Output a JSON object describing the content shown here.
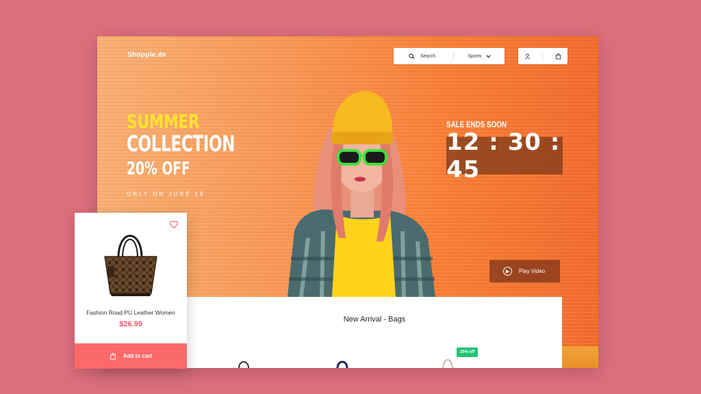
{
  "brand": "Shopple.de",
  "header": {
    "search_label": "Search",
    "category_selected": "Sports"
  },
  "hero": {
    "line1": "SUMMER",
    "line2": "COLLECTION",
    "line3": "20% OFF",
    "line4": "ONLY ON JUNE 18"
  },
  "sale": {
    "label": "SALE ENDS SOON",
    "timer": "12 : 30 : 45"
  },
  "video": {
    "label": "Play Video"
  },
  "panel": {
    "title": "New Arrival - Bags",
    "badge": "20% off"
  },
  "product_card": {
    "name": "Fashion Road PU Leather Women",
    "price": "$26.99",
    "cart_label": "Add to cart"
  },
  "colors": {
    "background": "#dc6f7c",
    "accent_yellow": "#ffe22e",
    "price": "#f3566a",
    "cart_button": "#fb6a6b",
    "badge": "#22c573"
  }
}
